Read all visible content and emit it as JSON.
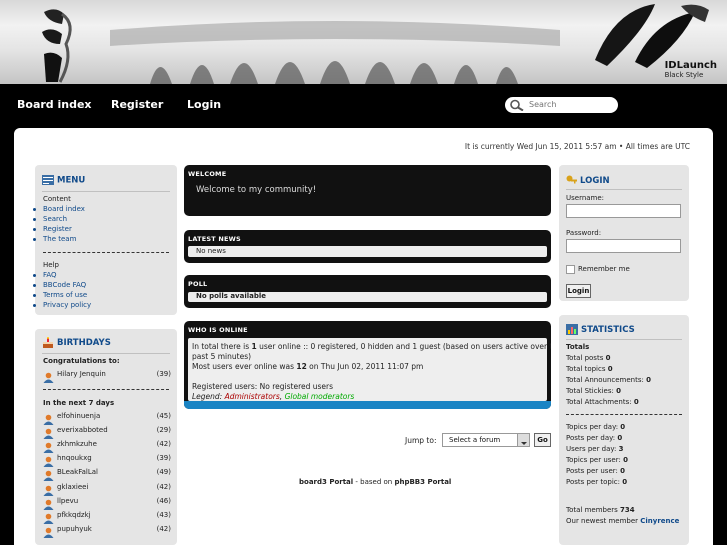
{
  "brand": {
    "title": "IDLaunch",
    "subtitle": "Black Style"
  },
  "nav": {
    "items": [
      "Board index",
      "Register",
      "Login"
    ],
    "search_placeholder": "Search"
  },
  "clock": "It is currently Wed Jun 15, 2011 5:57 am • All times are UTC",
  "menu": {
    "title": "MENU",
    "section1": "Content",
    "links1": [
      "Board index",
      "Search",
      "Register",
      "The team"
    ],
    "section2": "Help",
    "links2": [
      "FAQ",
      "BBCode FAQ",
      "Terms of use",
      "Privacy policy"
    ]
  },
  "birthdays": {
    "title": "BIRTHDAYS",
    "congrats": "Congratulations to:",
    "today": [
      {
        "name": "Hilary Jenquin",
        "age": "(39)"
      }
    ],
    "next_label": "In the next 7 days",
    "next": [
      {
        "name": "elfohinuenja",
        "age": "(45)"
      },
      {
        "name": "everixabboted",
        "age": "(29)"
      },
      {
        "name": "zkhmkzuhe",
        "age": "(42)"
      },
      {
        "name": "hnqoukxg",
        "age": "(39)"
      },
      {
        "name": "BLeakFalLal",
        "age": "(49)"
      },
      {
        "name": "gklaxieei",
        "age": "(42)"
      },
      {
        "name": "llpevu",
        "age": "(46)"
      },
      {
        "name": "pfkkqdzkj",
        "age": "(43)"
      },
      {
        "name": "pupuhyuk",
        "age": "(42)"
      }
    ]
  },
  "welcome": {
    "title": "WELCOME",
    "text": "Welcome to my community!"
  },
  "news": {
    "title": "LATEST NEWS",
    "text": "No news"
  },
  "poll": {
    "title": "POLL",
    "text": "No polls available"
  },
  "online": {
    "title": "WHO IS ONLINE",
    "l1a": "In total there is ",
    "l1b": "1",
    "l1c": " user online :: 0 registered, 0 hidden and 1 guest (based on users active over the",
    "l2": "past 5 minutes)",
    "l3a": "Most users ever online was ",
    "l3b": "12",
    "l3c": " on Thu Jun 02, 2011 11:07 pm",
    "l4": "Registered users: No registered users",
    "legend": "Legend:",
    "admins": "Administrators",
    "sep": ", ",
    "mods": "Global moderators"
  },
  "jump": {
    "label": "Jump to:",
    "selected": "Select a forum",
    "button": "Go"
  },
  "footer": {
    "a": "board3 Portal",
    "b": " - based on ",
    "c": "phpBB3 Portal"
  },
  "login": {
    "title": "LOGIN",
    "username": "Username:",
    "password": "Password:",
    "remember": "Remember me",
    "button": "Login"
  },
  "stats": {
    "title": "STATISTICS",
    "totals": "Totals",
    "rows1": [
      {
        "label": "Total posts ",
        "value": "0"
      },
      {
        "label": "Total topics ",
        "value": "0"
      },
      {
        "label": "Total Announcements: ",
        "value": "0"
      },
      {
        "label": "Total Stickies: ",
        "value": "0"
      },
      {
        "label": "Total Attachments: ",
        "value": "0"
      }
    ],
    "rows2": [
      {
        "label": "Topics per day: ",
        "value": "0"
      },
      {
        "label": "Posts per day: ",
        "value": "0"
      },
      {
        "label": "Users per day: ",
        "value": "3"
      },
      {
        "label": "Topics per user: ",
        "value": "0"
      },
      {
        "label": "Posts per user: ",
        "value": "0"
      },
      {
        "label": "Posts per topic: ",
        "value": "0"
      }
    ],
    "members_label": "Total members ",
    "members": "734",
    "newest_label": "Our newest member ",
    "newest": "Cinyrence"
  },
  "colors": {
    "link": "#104a8a",
    "admin": "#aa0000",
    "mod": "#00aa00",
    "online_bar": "#1a84c4"
  }
}
